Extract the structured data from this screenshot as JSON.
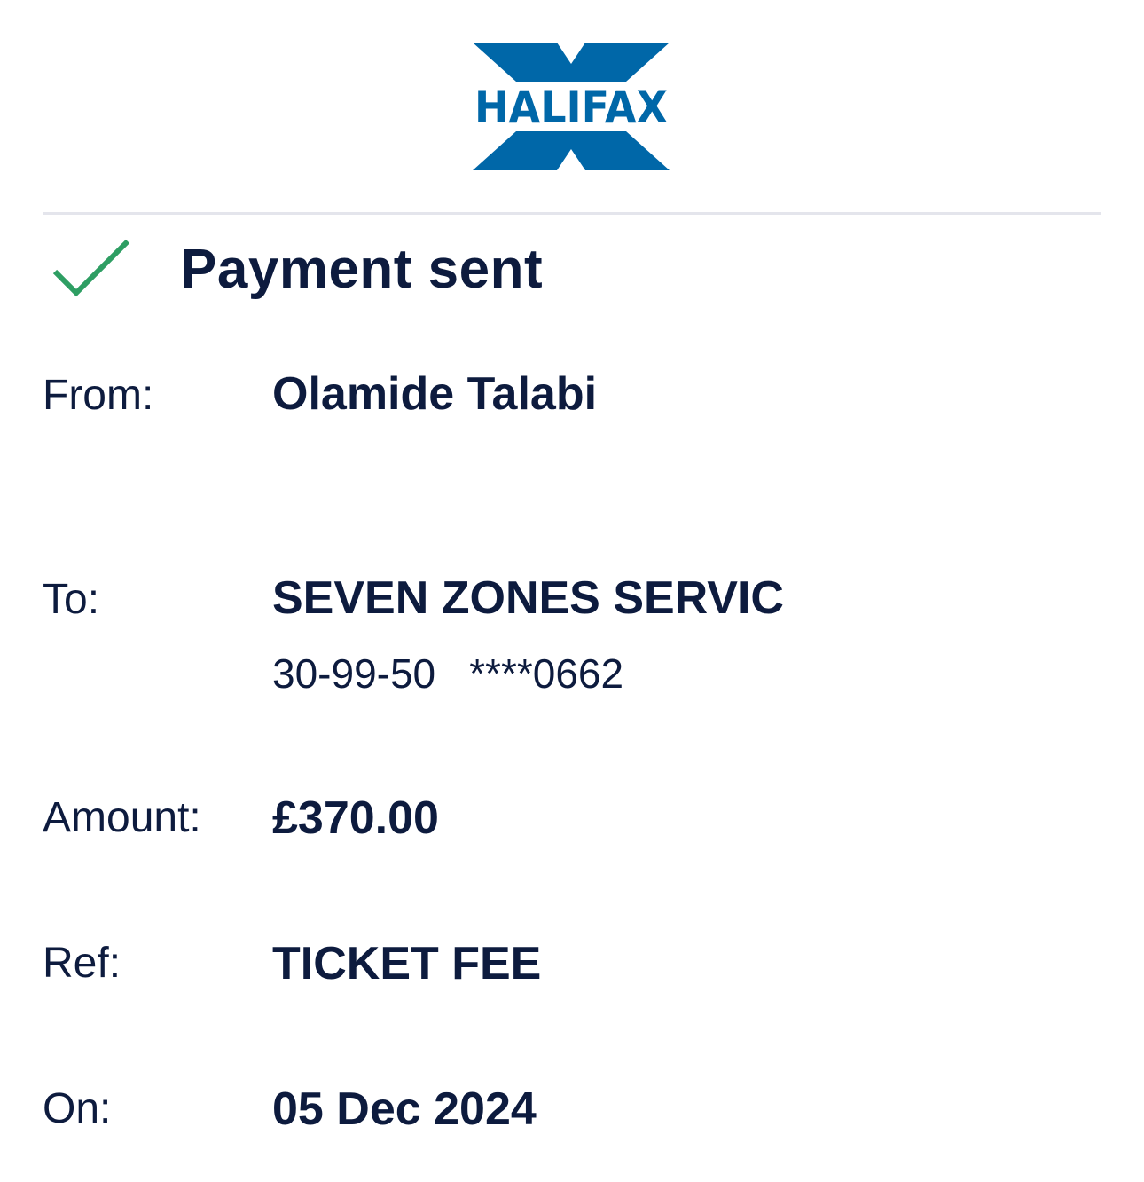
{
  "brand": {
    "logo_text": "HALIFAX",
    "color": "#0067a8"
  },
  "status": {
    "title": "Payment sent",
    "icon": "check-icon",
    "icon_color": "#2e9e63"
  },
  "details": {
    "from": {
      "label": "From:",
      "value": "Olamide Talabi"
    },
    "to": {
      "label": "To:",
      "value": "SEVEN ZONES SERVIC",
      "sort_code": "30-99-50",
      "account_number": "****0662"
    },
    "amount": {
      "label": "Amount:",
      "value": "£370.00"
    },
    "ref": {
      "label": "Ref:",
      "value": "TICKET FEE"
    },
    "on": {
      "label": "On:",
      "value": "05 Dec 2024"
    }
  }
}
